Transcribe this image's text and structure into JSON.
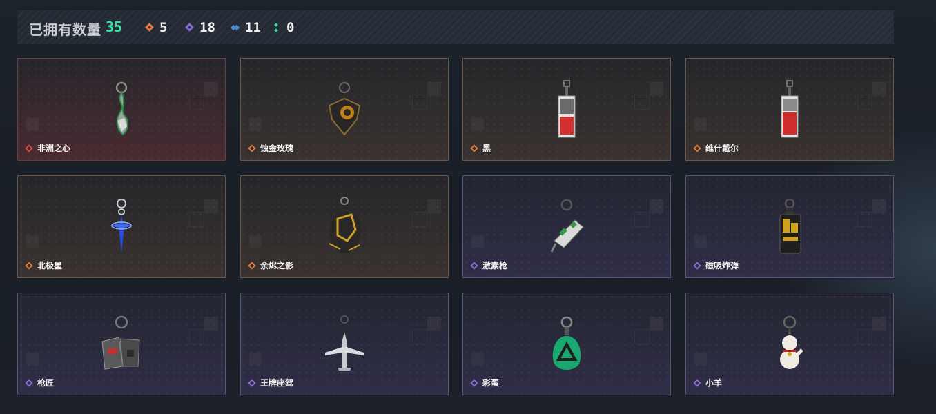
{
  "header": {
    "owned_label": "已拥有数量",
    "owned_count": "35",
    "stats": [
      {
        "icon": "orange-diamond-icon",
        "value": "5",
        "color": "#e07a3a"
      },
      {
        "icon": "purple-diamond-icon",
        "value": "18",
        "color": "#8a6ad8"
      },
      {
        "icon": "blue-diamond-icon",
        "value": "11",
        "color": "#4a8ad8"
      },
      {
        "icon": "green-dots-icon",
        "value": "0",
        "color": "#36d49a"
      }
    ]
  },
  "colors": {
    "red_rarity": "#d94a4a",
    "orange_rarity": "#e07a3a",
    "purple_rarity": "#8a6ad8",
    "accent_green": "#36e3a4"
  },
  "items": [
    {
      "name": "非洲之心",
      "rarity": "red",
      "icon": "heart-gem-charm-icon"
    },
    {
      "name": "蚀金玫瑰",
      "rarity": "orange",
      "icon": "rose-charm-icon"
    },
    {
      "name": "黑",
      "rarity": "orange",
      "icon": "card-tag-charm-icon"
    },
    {
      "name": "维什戴尔",
      "rarity": "orange",
      "icon": "card-tag-charm-icon"
    },
    {
      "name": "北极星",
      "rarity": "orange",
      "icon": "star-blade-charm-icon"
    },
    {
      "name": "余烬之影",
      "rarity": "orange",
      "icon": "ember-creature-charm-icon"
    },
    {
      "name": "激素枪",
      "rarity": "purple",
      "icon": "injector-gun-charm-icon"
    },
    {
      "name": "磁吸炸弹",
      "rarity": "purple",
      "icon": "bomb-charm-icon"
    },
    {
      "name": "枪匠",
      "rarity": "purple",
      "icon": "dogtag-charm-icon"
    },
    {
      "name": "王牌座驾",
      "rarity": "purple",
      "icon": "jet-plane-charm-icon"
    },
    {
      "name": "彩蛋",
      "rarity": "purple",
      "icon": "green-egg-charm-icon"
    },
    {
      "name": "小羊",
      "rarity": "purple",
      "icon": "lucky-cat-charm-icon"
    }
  ]
}
